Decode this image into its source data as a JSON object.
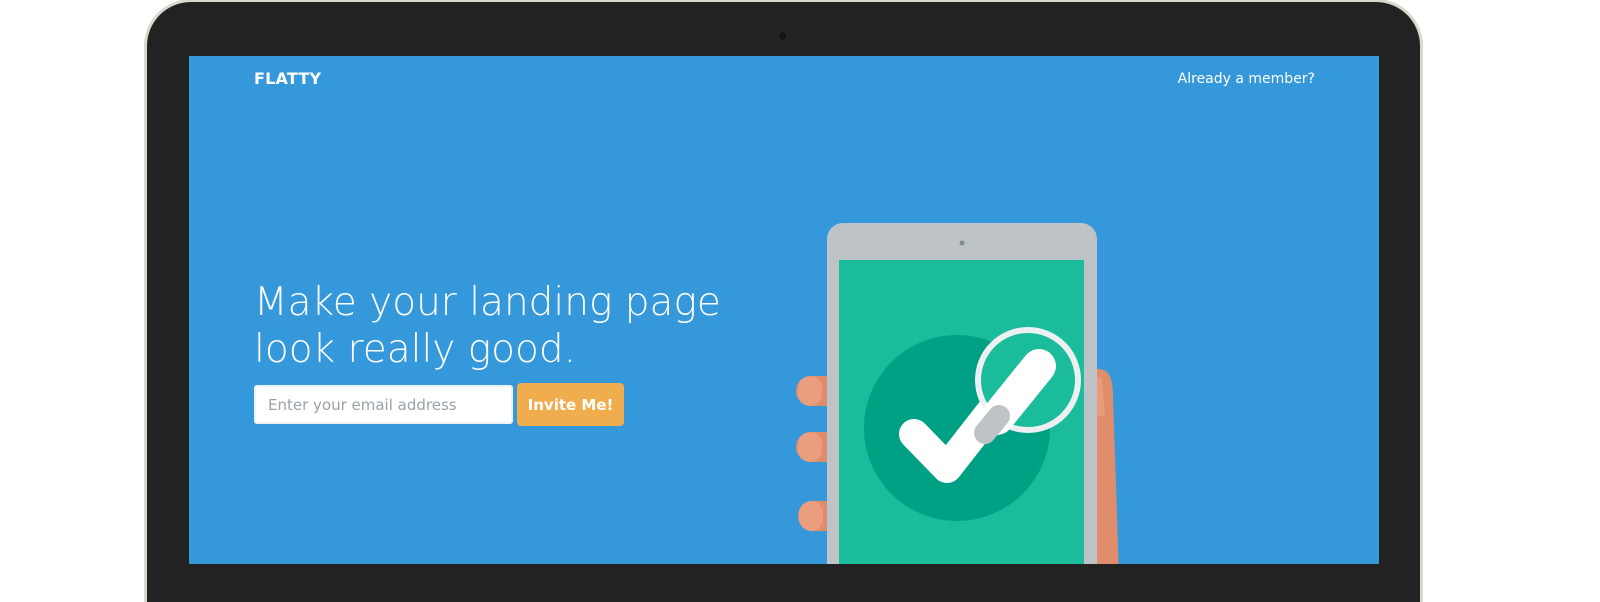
{
  "nav": {
    "brand": "FLATTY",
    "member_link": "Already a member?"
  },
  "hero": {
    "headline_line1": "Make your landing page",
    "headline_line2": "look really good."
  },
  "signup": {
    "email_placeholder": "Enter your email address",
    "email_value": "",
    "invite_label": "Invite Me!"
  },
  "colors": {
    "page_background": "#3598db",
    "accent_button": "#f0ad4e",
    "tablet_screen": "#1abc9c",
    "check_circle": "#00a085",
    "tablet_frame": "#bdc3c7",
    "hand": "#e08d6c"
  },
  "icons": {
    "illustration": "tablet-checkmark-illustration",
    "magnifier": "magnifier-icon",
    "checkmark": "checkmark-icon"
  }
}
